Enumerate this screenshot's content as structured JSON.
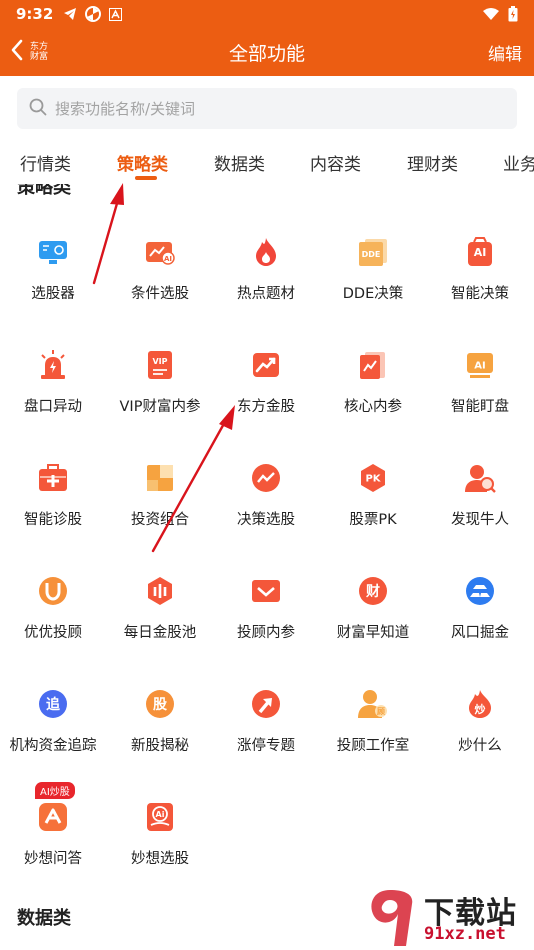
{
  "status_bar": {
    "time": "9:32"
  },
  "header": {
    "logo_line1": "东方",
    "logo_line2": "财富",
    "title": "全部功能",
    "edit_label": "编辑"
  },
  "search": {
    "placeholder": "搜索功能名称/关键词"
  },
  "tabs": [
    "行情类",
    "策略类",
    "数据类",
    "内容类",
    "理财类",
    "业务"
  ],
  "active_tab": "策略类",
  "partial_section_title": "策略类",
  "grid_items": [
    {
      "label": "选股器",
      "icon": "screen-monitor-icon",
      "color": "#2e9bf0"
    },
    {
      "label": "条件选股",
      "icon": "ai-chart-icon",
      "color": "#f3643a"
    },
    {
      "label": "热点题材",
      "icon": "flame-icon",
      "color": "#f1463a"
    },
    {
      "label": "DDE决策",
      "icon": "dde-doc-icon",
      "color": "#f6b35a"
    },
    {
      "label": "智能决策",
      "icon": "ai-bag-icon",
      "color": "#f4573a"
    },
    {
      "label": "盘口异动",
      "icon": "alarm-light-icon",
      "color": "#f4573a"
    },
    {
      "label": "VIP财富内参",
      "icon": "vip-card-icon",
      "color": "#f4573a"
    },
    {
      "label": "东方金股",
      "icon": "trend-up-icon",
      "color": "#f4573a"
    },
    {
      "label": "核心内参",
      "icon": "report-book-icon",
      "color": "#f4573a"
    },
    {
      "label": "智能盯盘",
      "icon": "ai-screen-icon",
      "color": "#f6a340"
    },
    {
      "label": "智能诊股",
      "icon": "medkit-icon",
      "color": "#f4573a"
    },
    {
      "label": "投资组合",
      "icon": "portfolio-blocks-icon",
      "color": "#f6a340"
    },
    {
      "label": "决策选股",
      "icon": "trend-circle-icon",
      "color": "#f4573a"
    },
    {
      "label": "股票PK",
      "icon": "pk-badge-icon",
      "color": "#f4573a"
    },
    {
      "label": "发现牛人",
      "icon": "user-search-icon",
      "color": "#f4573a"
    },
    {
      "label": "优优投顾",
      "icon": "magnet-circle-icon",
      "color": "#f6913a"
    },
    {
      "label": "每日金股池",
      "icon": "hexagon-coin-icon",
      "color": "#f4573a"
    },
    {
      "label": "投顾内参",
      "icon": "envelope-check-icon",
      "color": "#f4573a"
    },
    {
      "label": "财富早知道",
      "icon": "coin-cai-icon",
      "color": "#f4573a"
    },
    {
      "label": "风口掘金",
      "icon": "gold-bars-icon",
      "color": "#2e7cf0"
    },
    {
      "label": "机构资金追踪",
      "icon": "zhui-circle-icon",
      "color": "#4a6cf0"
    },
    {
      "label": "新股揭秘",
      "icon": "gu-circle-icon",
      "color": "#f6913a"
    },
    {
      "label": "涨停专题",
      "icon": "up-arrow-circle-icon",
      "color": "#f4573a"
    },
    {
      "label": "投顾工作室",
      "icon": "advisor-person-icon",
      "color": "#f6a340"
    },
    {
      "label": "炒什么",
      "icon": "chao-flame-icon",
      "color": "#f4573a"
    },
    {
      "label": "妙想问答",
      "icon": "miao-qa-icon",
      "color": "#f6713a",
      "badge": "AI炒股"
    },
    {
      "label": "妙想选股",
      "icon": "ai-phone-icon",
      "color": "#f4573a"
    }
  ],
  "next_section_title": "数据类",
  "watermark": {
    "brand": "下载站",
    "domain": "91xz.net"
  }
}
